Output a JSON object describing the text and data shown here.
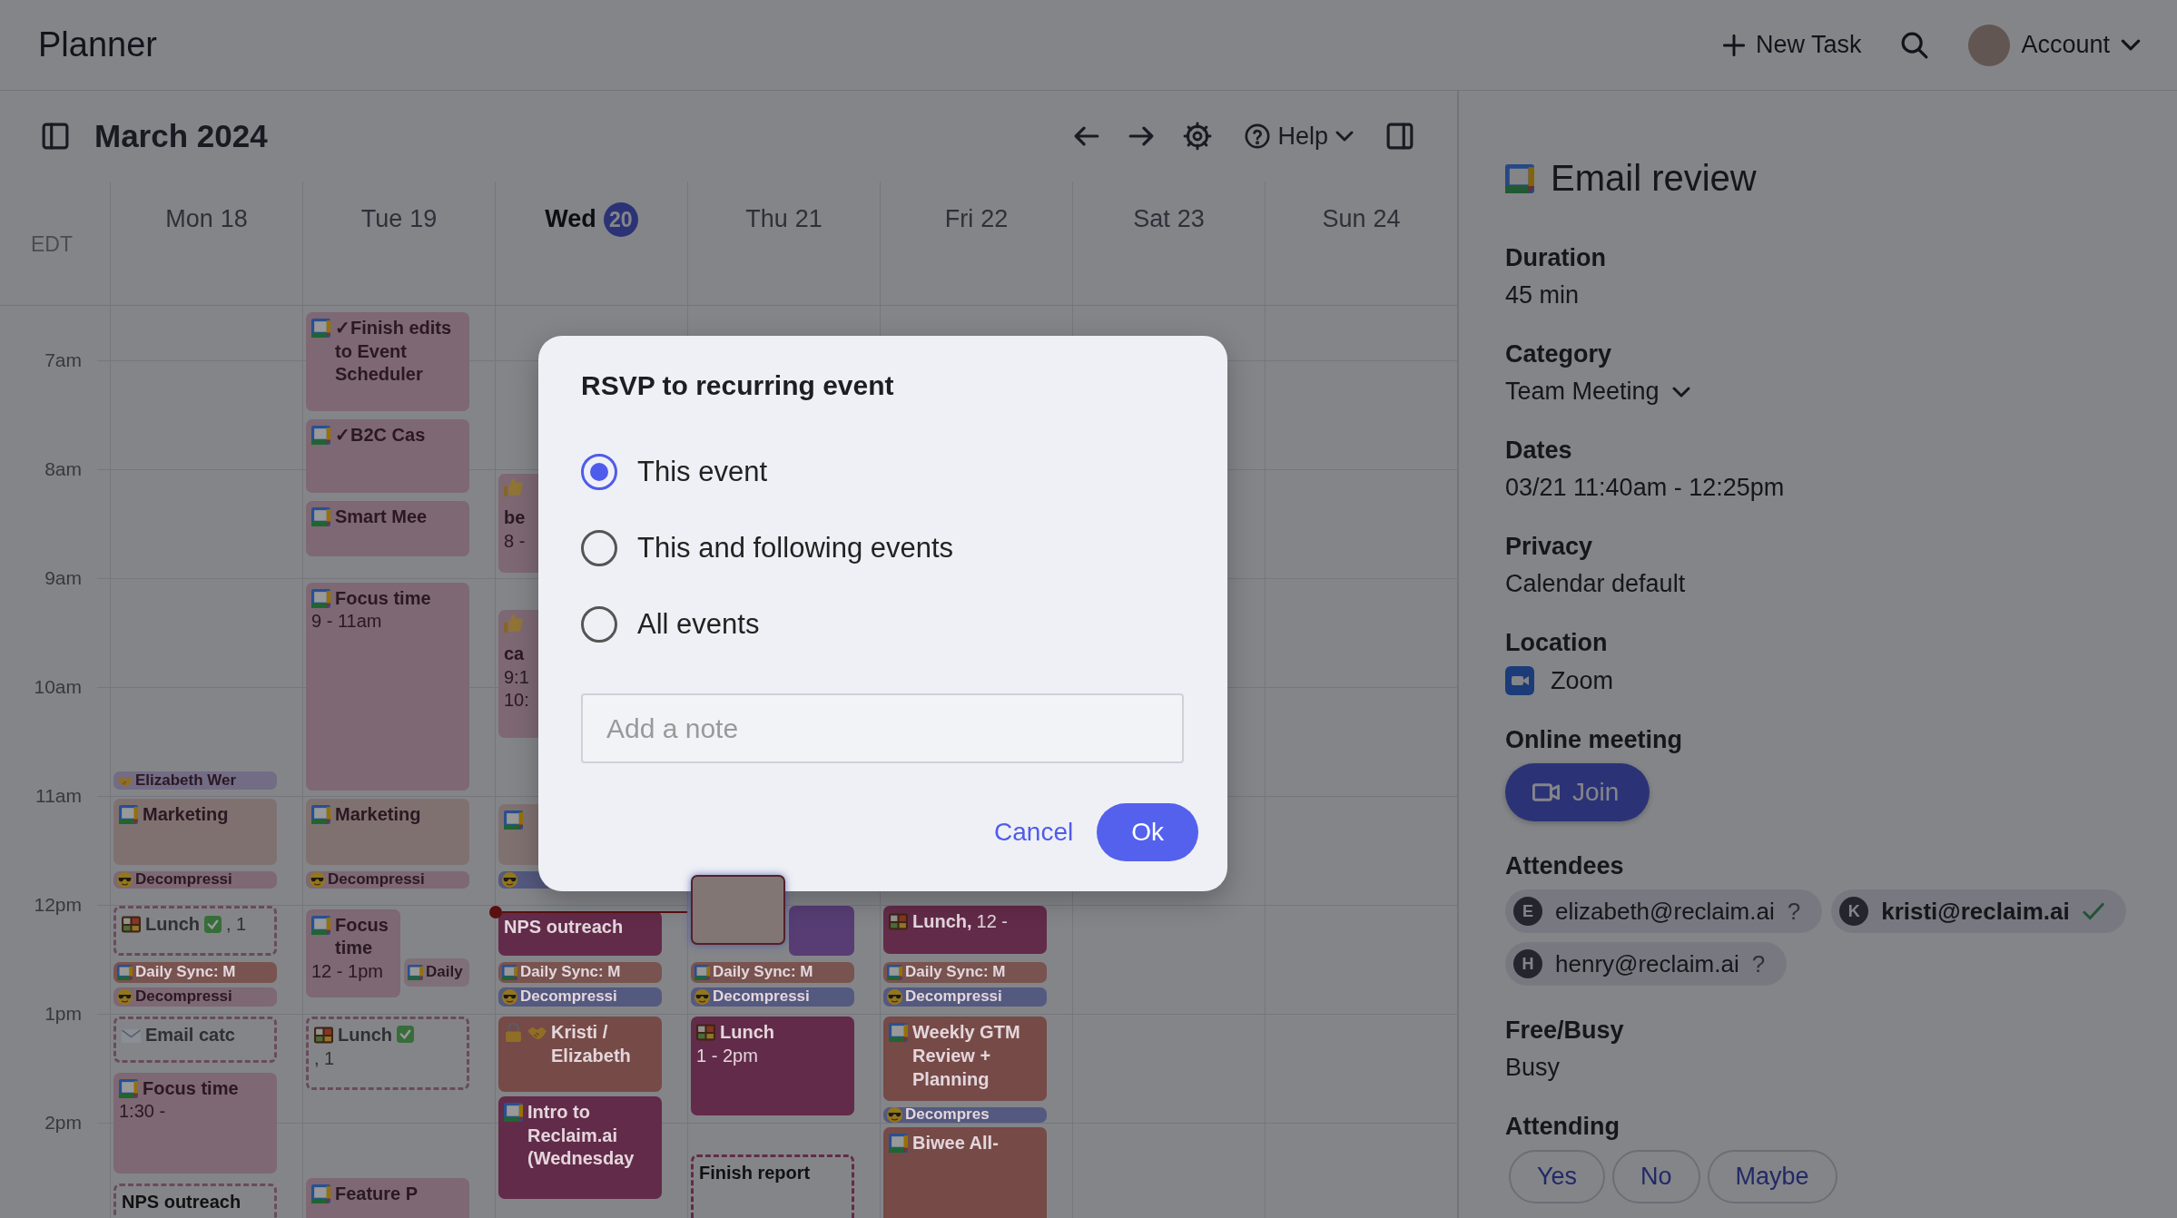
{
  "app": {
    "title": "Planner",
    "new_task": "New Task",
    "account": "Account"
  },
  "toolbar": {
    "month": "March 2024",
    "help": "Help"
  },
  "calendar": {
    "timezone": "EDT",
    "hours": [
      "7am",
      "8am",
      "9am",
      "10am",
      "11am",
      "12pm",
      "1pm",
      "2pm"
    ],
    "days": [
      {
        "weekday": "Mon",
        "date": "18",
        "today": false,
        "events": [
          {
            "title": "Elizabeth Wer",
            "kind": "handshake",
            "color": "#736c85",
            "tentative": false,
            "selected": false
          },
          {
            "title": "Marketing",
            "kind": "calendar",
            "color": "#807171",
            "tentative": false,
            "selected": false
          },
          {
            "title": "Decompressi",
            "kind": "decompress",
            "color": "#7d6874",
            "tentative": false,
            "selected": false
          },
          {
            "title": "Lunch",
            "done": true,
            "time": ", 1",
            "kind": "lunch",
            "color": "#694b5b",
            "tentative": true,
            "selected": false
          },
          {
            "title": "Daily Sync: M",
            "kind": "calendar",
            "color": "#78534f",
            "tentative": false,
            "selected": false
          },
          {
            "title": "Decompressi",
            "kind": "decompress",
            "color": "#7d6874",
            "tentative": false,
            "selected": false
          },
          {
            "title": "Email catc",
            "kind": "mail",
            "color": "#694b5b",
            "tentative": true,
            "selected": false
          },
          {
            "title": "Focus time",
            "time": "1:30 -",
            "kind": "calendar",
            "color": "#7d6874",
            "tentative": false,
            "selected": false
          },
          {
            "title": "NPS outreach",
            "kind": "none",
            "color": "#694b5b",
            "tentative": true,
            "selected": false
          }
        ]
      },
      {
        "weekday": "Tue",
        "date": "19",
        "today": false,
        "events": [
          {
            "title": "✓Finish edits to Event Scheduler",
            "kind": "calendar",
            "color": "#7d6874",
            "tentative": false,
            "selected": false
          },
          {
            "title": "✓B2C Cas",
            "kind": "calendar",
            "color": "#7d6874",
            "tentative": false,
            "selected": false
          },
          {
            "title": "Smart Mee",
            "kind": "calendar",
            "color": "#7d6874",
            "tentative": false,
            "selected": false
          },
          {
            "title": "Focus time",
            "time": "9 - 11am",
            "kind": "calendar",
            "color": "#7d6874",
            "tentative": false,
            "selected": false
          },
          {
            "title": "Marketing",
            "kind": "calendar",
            "color": "#807171",
            "tentative": false,
            "selected": false
          },
          {
            "title": "Decompressi",
            "kind": "decompress",
            "color": "#7d6874",
            "tentative": false,
            "selected": false
          },
          {
            "title": "Focus time",
            "time": "12 - 1pm",
            "kind": "calendar",
            "color": "#7d6874",
            "tentative": false,
            "selected": false
          },
          {
            "title": "Daily",
            "kind": "calendar",
            "color": "#7e6f79",
            "tentative": false,
            "selected": false
          },
          {
            "title": "Lunch",
            "done": true,
            "time": ", 1",
            "kind": "lunch",
            "color": "#694b5b",
            "tentative": true,
            "selected": false
          },
          {
            "title": "Feature P",
            "kind": "calendar",
            "color": "#7d6874",
            "tentative": false,
            "selected": false
          }
        ]
      },
      {
        "weekday": "Wed",
        "date": "20",
        "today": true,
        "current_time": true,
        "events": [
          {
            "title": "be",
            "time": "8 -",
            "kind": "thumbs",
            "color": "#7d6874",
            "tentative": false,
            "selected": false
          },
          {
            "title": "ca",
            "time": "9:1",
            "time_more": "10:",
            "kind": "thumbs",
            "color": "#7d6874",
            "tentative": false,
            "selected": false
          },
          {
            "kind": "calendar",
            "color": "#807171",
            "tentative": false,
            "selected": false
          },
          {
            "kind": "decompress",
            "color": "#54597f",
            "tentative": false,
            "selected": false
          },
          {
            "title": "NPS outreach",
            "kind": "none",
            "color": "#622b49",
            "tentative": false,
            "selected": false
          },
          {
            "title": "Daily Sync: M",
            "kind": "calendar",
            "color": "#78534f",
            "tentative": false,
            "selected": false
          },
          {
            "title": "Decompressi",
            "kind": "decompress",
            "color": "#54597f",
            "tentative": false,
            "selected": false
          },
          {
            "title": "Kristi / Elizabeth",
            "kind": "lock-handshake",
            "color": "#764a47",
            "tentative": false,
            "selected": false
          },
          {
            "title": "Intro to Reclaim.ai (Wednesday",
            "kind": "calendar",
            "color": "#622b49",
            "tentative": false,
            "selected": false
          }
        ]
      },
      {
        "weekday": "Thu",
        "date": "21",
        "today": false,
        "events": [
          {
            "kind": "none",
            "color": "#817674",
            "tentative": false,
            "selected": true
          },
          {
            "kind": "none",
            "color": "#573d74",
            "tentative": false,
            "selected": false
          },
          {
            "title": "Daily Sync: M",
            "kind": "calendar",
            "color": "#78534f",
            "tentative": false,
            "selected": false
          },
          {
            "title": "Decompressi",
            "kind": "decompress",
            "color": "#54597f",
            "tentative": false,
            "selected": false
          },
          {
            "title": "Lunch",
            "time": "1 - 2pm",
            "kind": "lunch",
            "color": "#622b49",
            "tentative": false,
            "selected": false
          },
          {
            "title": "Finish report",
            "kind": "none",
            "color": "#622b49",
            "tentative": true,
            "selected": false
          }
        ]
      },
      {
        "weekday": "Fri",
        "date": "22",
        "today": false,
        "events": [
          {
            "title": "Lunch,",
            "time": "12 -",
            "kind": "lunch",
            "color": "#622b49",
            "tentative": false,
            "selected": false
          },
          {
            "title": "Daily Sync: M",
            "kind": "calendar",
            "color": "#78534f",
            "tentative": false,
            "selected": false
          },
          {
            "title": "Decompressi",
            "kind": "decompress",
            "color": "#54597f",
            "tentative": false,
            "selected": false
          },
          {
            "title": "Weekly GTM Review + Planning",
            "kind": "calendar",
            "color": "#764a47",
            "tentative": false,
            "selected": false
          },
          {
            "title": "Decompres",
            "kind": "decompress",
            "color": "#54597f",
            "tentative": false,
            "selected": false
          },
          {
            "title": "Biwee All-",
            "kind": "calendar",
            "color": "#764a47",
            "tentative": false,
            "selected": false
          }
        ]
      },
      {
        "weekday": "Sat",
        "date": "23",
        "today": false
      },
      {
        "weekday": "Sun",
        "date": "24",
        "today": false
      }
    ]
  },
  "details": {
    "title": "Email review",
    "fields": [
      {
        "kind": "text",
        "label": "Duration",
        "value": "45 min"
      },
      {
        "kind": "dropdown",
        "label": "Category",
        "value": "Team Meeting"
      },
      {
        "kind": "text",
        "label": "Dates",
        "value": "03/21 11:40am - 12:25pm"
      },
      {
        "kind": "text",
        "label": "Privacy",
        "value": "Calendar default"
      },
      {
        "kind": "location",
        "label": "Location",
        "value": "Zoom"
      },
      {
        "kind": "join",
        "label": "Online meeting",
        "button": "Join"
      },
      {
        "kind": "attendees",
        "label": "Attendees",
        "attendees": [
          {
            "initial": "E",
            "email": "elizabeth@reclaim.ai",
            "organizer": false,
            "accepted": false,
            "mark": "?"
          },
          {
            "initial": "K",
            "email": "kristi@reclaim.ai",
            "organizer": true,
            "accepted": true
          },
          {
            "initial": "H",
            "email": "henry@reclaim.ai",
            "organizer": false,
            "accepted": false,
            "mark": "?"
          }
        ]
      },
      {
        "kind": "text",
        "label": "Free/Busy",
        "value": "Busy"
      },
      {
        "kind": "choice",
        "label": "Attending",
        "options": [
          {
            "label": "Yes",
            "selected": false
          },
          {
            "label": "No",
            "selected": false
          },
          {
            "label": "Maybe",
            "selected": false
          }
        ]
      }
    ]
  },
  "dialog": {
    "title": "RSVP to recurring event",
    "options": [
      {
        "label": "This event",
        "selected": true
      },
      {
        "label": "This and following events",
        "selected": false
      },
      {
        "label": "All events",
        "selected": false
      }
    ],
    "note": {
      "placeholder": "Add a note"
    },
    "cancel": "Cancel",
    "ok": "Ok"
  }
}
